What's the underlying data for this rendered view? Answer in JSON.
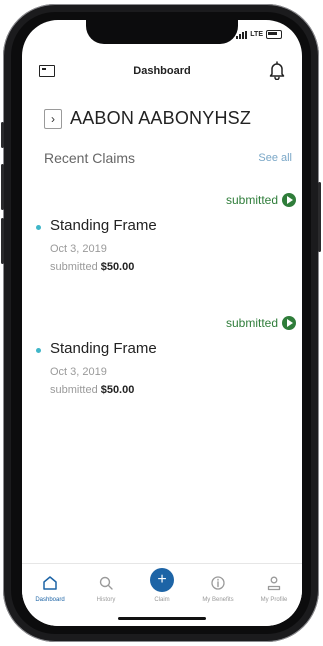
{
  "status_bar": {
    "network": "LTE"
  },
  "header": {
    "title": "Dashboard",
    "menu_icon": "card-menu-icon",
    "bell_icon": "bell-icon"
  },
  "member": {
    "name": "AABON AABONYHSZ",
    "chevron_icon": "chevron-right-icon"
  },
  "recent": {
    "heading": "Recent Claims",
    "see_all": "See all"
  },
  "claims": [
    {
      "status": "submitted",
      "name": "Standing Frame",
      "date": "Oct 3, 2019",
      "status_label": "submitted",
      "amount": "$50.00"
    },
    {
      "status": "submitted",
      "name": "Standing Frame",
      "date": "Oct 3, 2019",
      "status_label": "submitted",
      "amount": "$50.00"
    }
  ],
  "tabs": [
    {
      "label": "Dashboard",
      "icon": "home-icon",
      "active": true
    },
    {
      "label": "History",
      "icon": "search-icon",
      "active": false
    },
    {
      "label": "Claim",
      "icon": "plus-icon",
      "active": false
    },
    {
      "label": "My Benefits",
      "icon": "info-icon",
      "active": false
    },
    {
      "label": "My Profile",
      "icon": "profile-icon",
      "active": false
    }
  ],
  "colors": {
    "accent_blue": "#1d64a6",
    "status_green": "#2f7d3a",
    "dot_teal": "#3fb6c8",
    "link_blue": "#7aa7c7"
  }
}
